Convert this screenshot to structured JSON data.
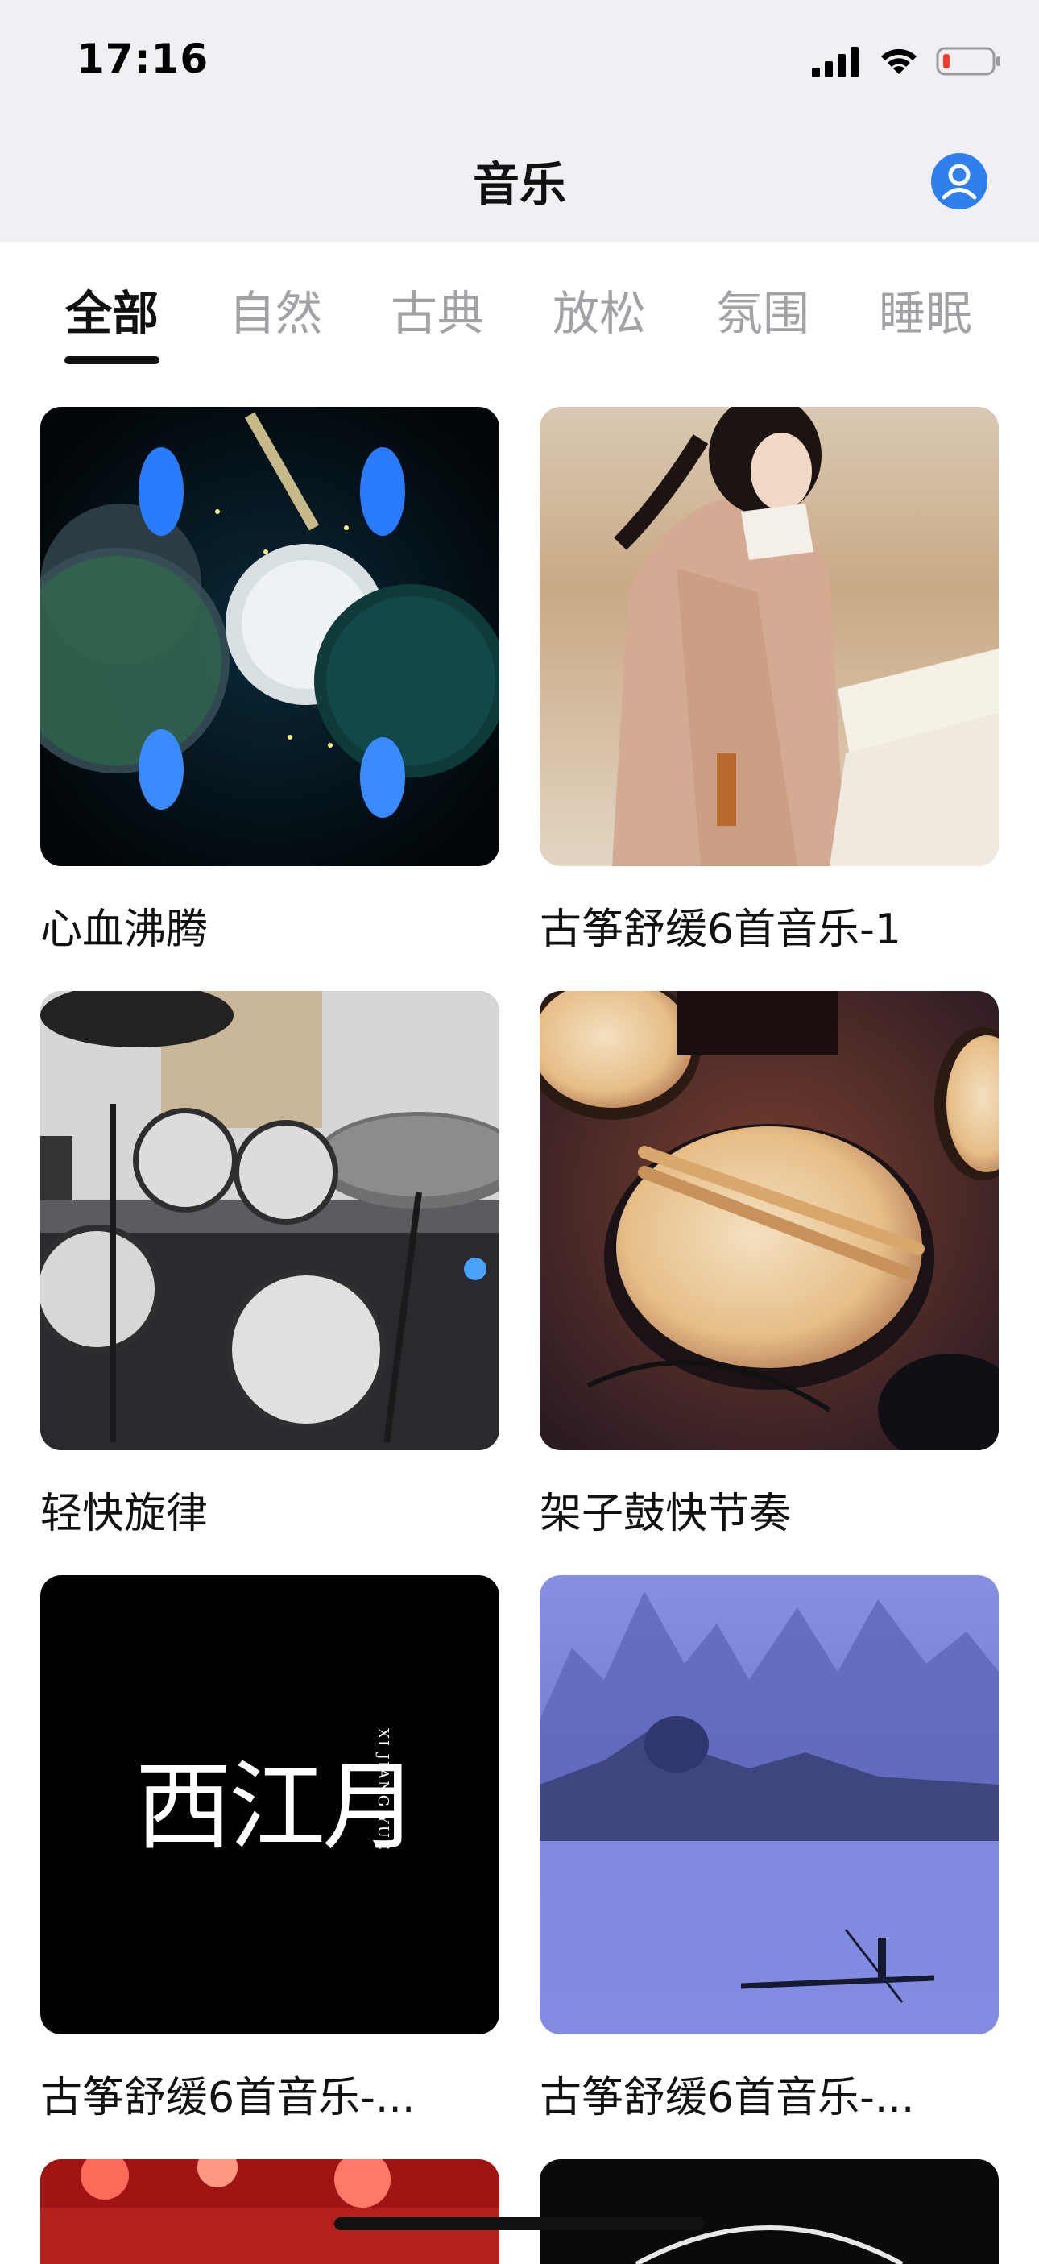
{
  "status_bar": {
    "time": "17:16"
  },
  "nav": {
    "title": "音乐",
    "avatar_icon": "user-avatar-icon"
  },
  "tabs": [
    {
      "label": "全部",
      "active": true
    },
    {
      "label": "自然",
      "active": false
    },
    {
      "label": "古典",
      "active": false
    },
    {
      "label": "放松",
      "active": false
    },
    {
      "label": "氛围",
      "active": false
    },
    {
      "label": "睡眠",
      "active": false
    }
  ],
  "cards": [
    {
      "title": "心血沸腾"
    },
    {
      "title": "古筝舒缓6首音乐-1"
    },
    {
      "title": "轻快旋律"
    },
    {
      "title": "架子鼓快节奏"
    },
    {
      "title": "古筝舒缓6首音乐-..."
    },
    {
      "title": "古筝舒缓6首音乐-..."
    }
  ],
  "album_art_text": {
    "main": "西江月",
    "vertical": "XI JIANG YUE"
  },
  "colors": {
    "header_bg": "#efeff4",
    "accent": "#2f80ed",
    "battery_low": "#ff3b30"
  }
}
